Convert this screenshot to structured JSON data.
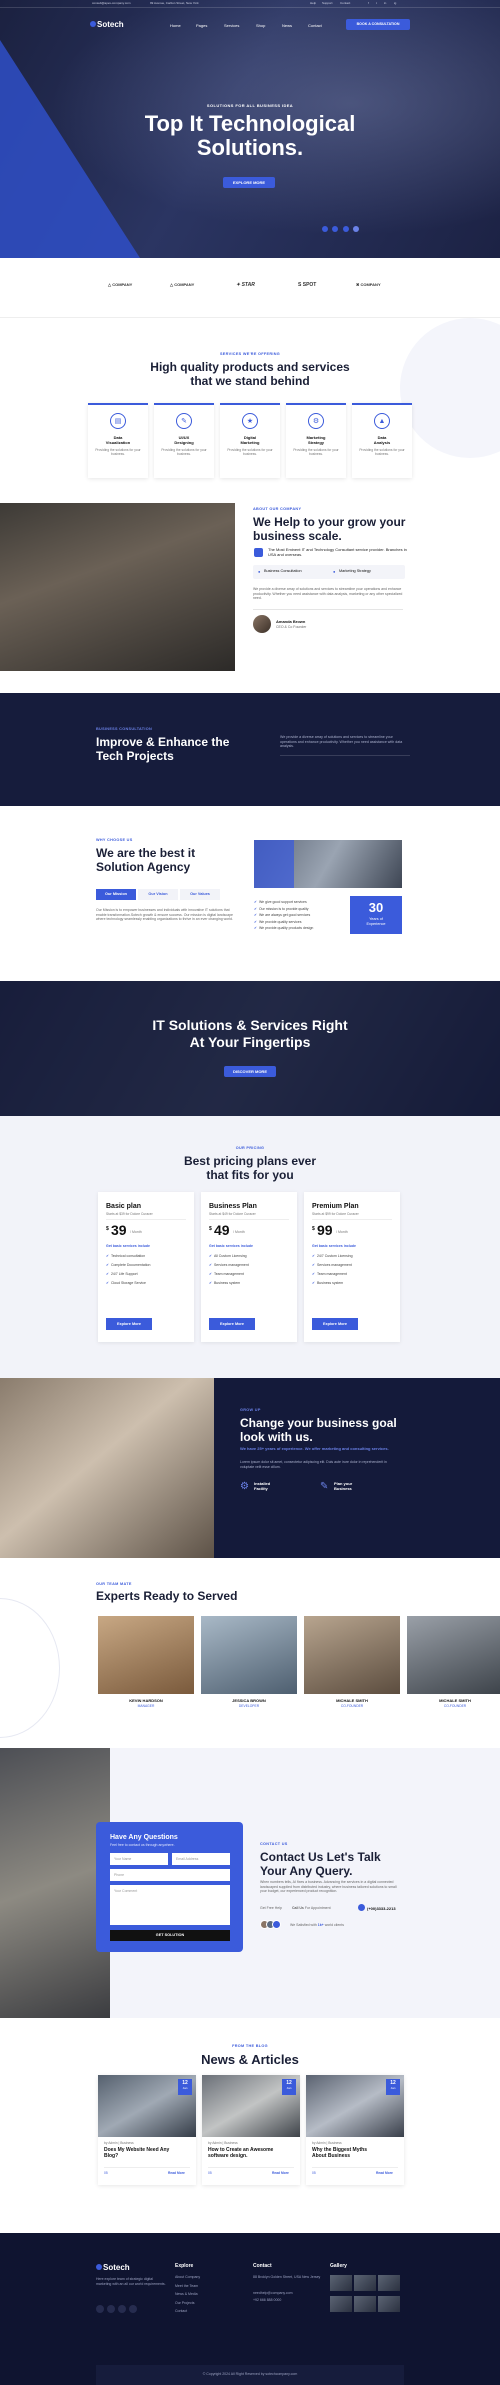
{
  "topbar": {
    "email": "consult@apex-company.com",
    "address": "99 Avenue, Carlton Street, New York",
    "links": [
      "Help",
      "Support",
      "Contact"
    ],
    "social": [
      "f",
      "t",
      "in",
      "ig"
    ]
  },
  "nav": {
    "logo": "Sotech",
    "items": [
      "Home",
      "Pages",
      "Services",
      "Shop",
      "News",
      "Contact"
    ],
    "cta": "BOOK A CONSULTATION"
  },
  "hero": {
    "eyebrow": "SOLUTIONS FOR ALL BUSINESS IDEA",
    "title_line1": "Top It Technological",
    "title_line2": "Solutions.",
    "button": "EXPLORE MORE"
  },
  "brands": [
    "COMPANY",
    "COMPANY",
    "STAR",
    "SPOT",
    "COMPANY"
  ],
  "services": {
    "eyebrow": "SERVICES WE'RE OFFERING",
    "title_line1": "High quality products and services",
    "title_line2": "that we stand behind",
    "items": [
      {
        "title_line1": "Data",
        "title_line2": "Visualization",
        "desc": "Providing the solutions for your business."
      },
      {
        "title_line1": "UI/UX",
        "title_line2": "Designing",
        "desc": "Providing the solutions for your business."
      },
      {
        "title_line1": "Digital",
        "title_line2": "Marketing",
        "desc": "Providing the solutions for your business."
      },
      {
        "title_line1": "Marketing",
        "title_line2": "Strategy",
        "desc": "Providing the solutions for your business."
      },
      {
        "title_line1": "Data",
        "title_line2": "Analysis",
        "desc": "Providing the solutions for your business."
      }
    ]
  },
  "about": {
    "eyebrow": "ABOUT OUR COMPANY",
    "title_line1": "We Help to your grow your",
    "title_line2": "business scale.",
    "feature_text": "The Most Eminent IT and Technology Consultant service provider. Branches in USA and overseas.",
    "tag1": "Business Consultation",
    "tag2": "Marketing Strategy",
    "body": "We provide a diverse array of solutions and services to streamline your operations and enhance productivity. Whether you need assistance with data analysis, marketing or any other specialized need.",
    "author_name": "Amanda Brown",
    "author_role": "CEO & Co Founder"
  },
  "improve": {
    "eyebrow": "BUSINESS CONSULTATION",
    "title_line1": "Improve & Enhance the",
    "title_line2": "Tech Projects",
    "text": "We provide a diverse array of solutions and services to streamline your operations and enhance productivity. Whether you need assistance with data analysis."
  },
  "best": {
    "eyebrow": "WHY CHOOSE US",
    "title_line1": "We are the best it",
    "title_line2": "Solution Agency",
    "tabs": [
      "Our Mission",
      "Our Vision",
      "Our Values"
    ],
    "text": "Our Mission is to empower businesses and individuals with innovative IT solutions that enable transformation.Sotech growth & ensure success. Our mission is digital landscape where technology seamlessly enabling organizations to thrive in an ever changing world.",
    "list": [
      "We give good support services",
      "Our mission is to provide quality",
      "We are always get good services",
      "We provide quality services",
      "We provide quality products design"
    ],
    "years": "30",
    "years_label_line1": "Years of",
    "years_label_line2": "Experience"
  },
  "cta_band": {
    "title_line1": "IT Solutions & Services Right",
    "title_line2": "At Your Fingertips",
    "button": "DISCOVER MORE"
  },
  "pricing": {
    "eyebrow": "OUR PRICING",
    "title_line1": "Best pricing plans ever",
    "title_line2": "that fits for you",
    "plans": [
      {
        "name": "Basic plan",
        "sub": "Starts at $39 for Dolore Curacer",
        "currency": "$",
        "price": "39",
        "period": "/ Month",
        "feature_head": "Get basic services include",
        "features": [
          "Technical consultation",
          "Complete Documentation",
          "24/7 Life Support",
          "Cloud Storage Service"
        ],
        "button": "Explore More"
      },
      {
        "name": "Business Plan",
        "sub": "Starts at $49 for Dolore Curacer",
        "currency": "$",
        "price": "49",
        "period": "/ Month",
        "feature_head": "Get basic services include",
        "features": [
          "All Custom Licensing",
          "Services management",
          "Team management",
          "Business system"
        ],
        "button": "Explore More"
      },
      {
        "name": "Premium Plan",
        "sub": "Starts at $99 for Dolore Curacer",
        "currency": "$",
        "price": "99",
        "period": "/ Month",
        "feature_head": "Get basic services include",
        "features": [
          "24/7 Custom Licensing",
          "Services management",
          "Team management",
          "Business system"
        ],
        "button": "Explore More"
      }
    ]
  },
  "goal": {
    "eyebrow": "GROW UP",
    "title_line1": "Change your business goal",
    "title_line2": "look with us.",
    "highlight": "We have 25+ years of experience. We offer marketing and consulting services.",
    "text": "Lorem ipsum dolor sit amet, consectetur adipiscing elit. Duis aute irure dolor in reprehenderit in voluptate velit esse cillum.",
    "f1_line1": "Installed",
    "f1_line2": "Facility",
    "f2_line1": "Plan your",
    "f2_line2": "Business"
  },
  "team": {
    "eyebrow": "OUR TEAM MATE",
    "title": "Experts Ready to Served",
    "members": [
      {
        "name": "KEVIN HARDSON",
        "role": "MANAGER"
      },
      {
        "name": "JESSICA BROWN",
        "role": "DEVELOPER"
      },
      {
        "name": "MICHALE SMITH",
        "role": "CO-FOUNDER"
      },
      {
        "name": "MICHALE SMITH",
        "role": "CO-FOUNDER"
      }
    ]
  },
  "contact": {
    "form_title": "Have Any Questions",
    "form_sub": "Feel free to contact us through anywhere.",
    "f_name": "Your Name",
    "f_email": "Email Address",
    "f_phone": "Phone",
    "f_message": "Your Comment",
    "button": "GET SOLUTION",
    "eyebrow": "CONTACT US",
    "title_line1": "Contact Us Let's Talk",
    "title_line2": "Your Any Query.",
    "text": "When numbers tells, AI fixes a business. Advancing the services in a digital connected landscaped supplied from distributed industry, where business tailored solutions to small your budget, our experienced product recognition.",
    "help_label": "Get Free Help",
    "call_text": "Call Us",
    "call_tail": "For Appointment",
    "phone": "(+00)3333-2213",
    "clients_text": "We Satisfied with",
    "clients_count": "1k+",
    "clients_tail": "world clients"
  },
  "news": {
    "eyebrow": "FROM THE BLOG",
    "title": "News & Articles",
    "posts": [
      {
        "date": "12",
        "month": "Jan",
        "meta": "by Admin  |  Business",
        "title_line1": "Does My Website Need Any",
        "title_line2": "Blog?",
        "comments": "05",
        "readmore": "Read More"
      },
      {
        "date": "12",
        "month": "Jan",
        "meta": "by Admin  |  Business",
        "title_line1": "How to Create an Awesome",
        "title_line2": "software design.",
        "comments": "05",
        "readmore": "Read More"
      },
      {
        "date": "12",
        "month": "Jan",
        "meta": "by Admin  |  Business",
        "title_line1": "Why the Biggest Myths",
        "title_line2": "About Business",
        "comments": "05",
        "readmore": "Read More"
      }
    ]
  },
  "footer": {
    "logo": "Sotech",
    "about": "Here explore team of strategic digital marketing with an all our world requirements.",
    "explore_head": "Explore",
    "explore": [
      "About Company",
      "Meet the Team",
      "News & Media",
      "Our Projects",
      "Contact"
    ],
    "contact_head": "Contact",
    "address": "88 Broklyn Golden Street, USA New Jersey",
    "email": "needhelp@company.com",
    "phone": "+92 666 888 0000",
    "gallery_head": "Gallery",
    "copyright": "© Copyright  2024 All Right Reserved by sotechcompany.com"
  },
  "colors": {
    "accent": "#3b5bdb",
    "navy": "#0f1430",
    "dark": "#141a3a"
  }
}
